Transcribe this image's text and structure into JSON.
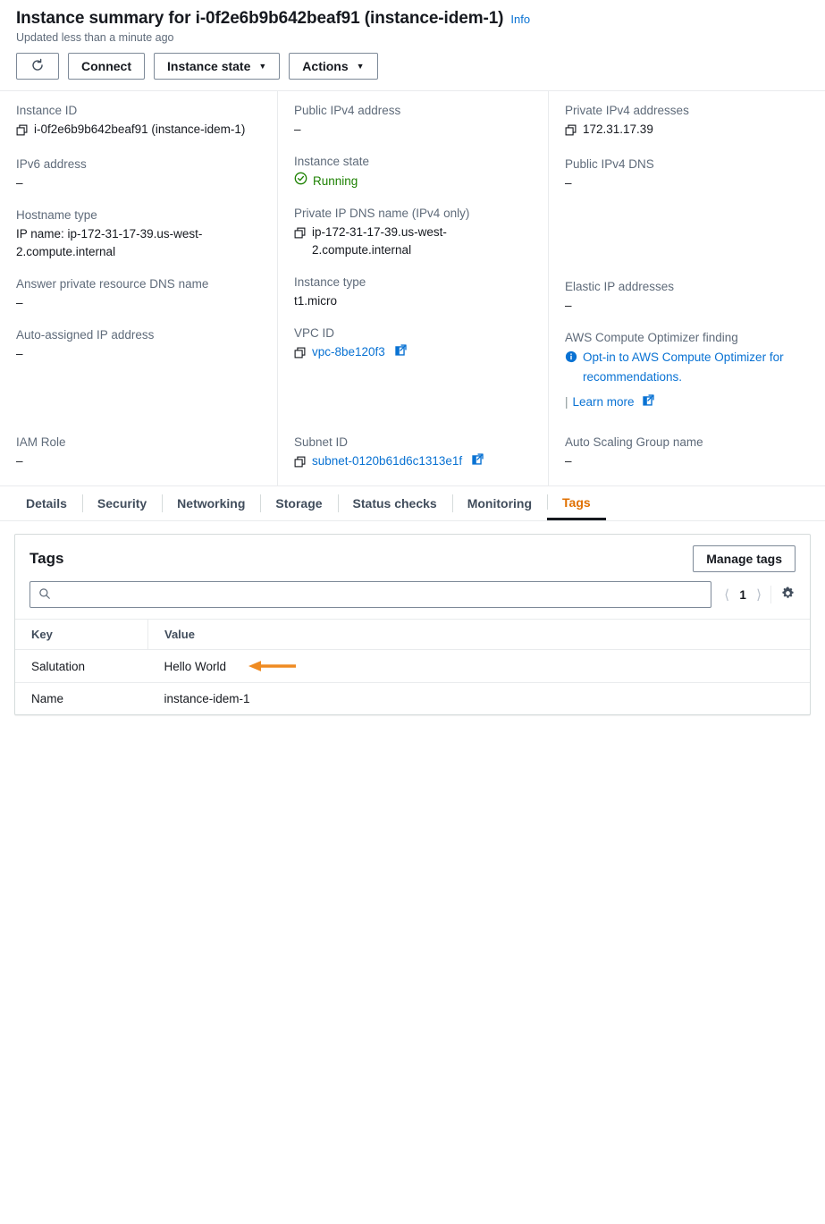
{
  "header": {
    "title": "Instance summary for i-0f2e6b9b642beaf91 (instance-idem-1)",
    "info_label": "Info",
    "updated": "Updated less than a minute ago",
    "buttons": {
      "refresh": "refresh-icon",
      "connect": "Connect",
      "instance_state": "Instance state",
      "actions": "Actions"
    }
  },
  "details": {
    "col1": [
      {
        "label": "Instance ID",
        "value": "i-0f2e6b9b642beaf91 (instance-idem-1)",
        "copy": true
      },
      {
        "label": "IPv6 address",
        "value": "–"
      },
      {
        "label": "Hostname type",
        "value": "IP name: ip-172-31-17-39.us-west-2.compute.internal"
      },
      {
        "label": "Answer private resource DNS name",
        "value": "–"
      },
      {
        "label": "Auto-assigned IP address",
        "value": "–"
      }
    ],
    "col2": [
      {
        "label": "Public IPv4 address",
        "value": "–"
      },
      {
        "label": "Instance state",
        "value": "Running",
        "status": "running"
      },
      {
        "label": "Private IP DNS name (IPv4 only)",
        "value": "ip-172-31-17-39.us-west-2.compute.internal",
        "copy": true
      },
      {
        "label": "Instance type",
        "value": "t1.micro"
      },
      {
        "label": "VPC ID",
        "value": "vpc-8be120f3",
        "copy": true,
        "link": true,
        "external": true
      }
    ],
    "col3": [
      {
        "label": "Private IPv4 addresses",
        "value": "172.31.17.39",
        "copy": true
      },
      {
        "label": "Public IPv4 DNS",
        "value": "–"
      },
      {
        "label": "Elastic IP addresses",
        "value": "–"
      },
      {
        "label": "AWS Compute Optimizer finding",
        "value": "Opt-in to AWS Compute Optimizer for recommendations.",
        "info": true,
        "learn_more": "Learn more"
      }
    ],
    "bottom": [
      {
        "label": "IAM Role",
        "value": "–"
      },
      {
        "label": "Subnet ID",
        "value": "subnet-0120b61d6c1313e1f",
        "copy": true,
        "link": true,
        "external": true
      },
      {
        "label": "Auto Scaling Group name",
        "value": "–"
      }
    ]
  },
  "tabs": [
    {
      "label": "Details",
      "active": false
    },
    {
      "label": "Security",
      "active": false
    },
    {
      "label": "Networking",
      "active": false
    },
    {
      "label": "Storage",
      "active": false
    },
    {
      "label": "Status checks",
      "active": false
    },
    {
      "label": "Monitoring",
      "active": false
    },
    {
      "label": "Tags",
      "active": true
    }
  ],
  "tags_panel": {
    "title": "Tags",
    "manage_button": "Manage tags",
    "search_value": "",
    "search_placeholder": "",
    "page_number": "1",
    "columns": [
      "Key",
      "Value"
    ],
    "rows": [
      {
        "key": "Salutation",
        "value": "Hello World",
        "annotated": true
      },
      {
        "key": "Name",
        "value": "instance-idem-1",
        "annotated": false
      }
    ]
  },
  "colors": {
    "link": "#0972d3",
    "active_tab": "#e07000",
    "running": "#1d8102",
    "annotation_arrow": "#ef8b22"
  }
}
